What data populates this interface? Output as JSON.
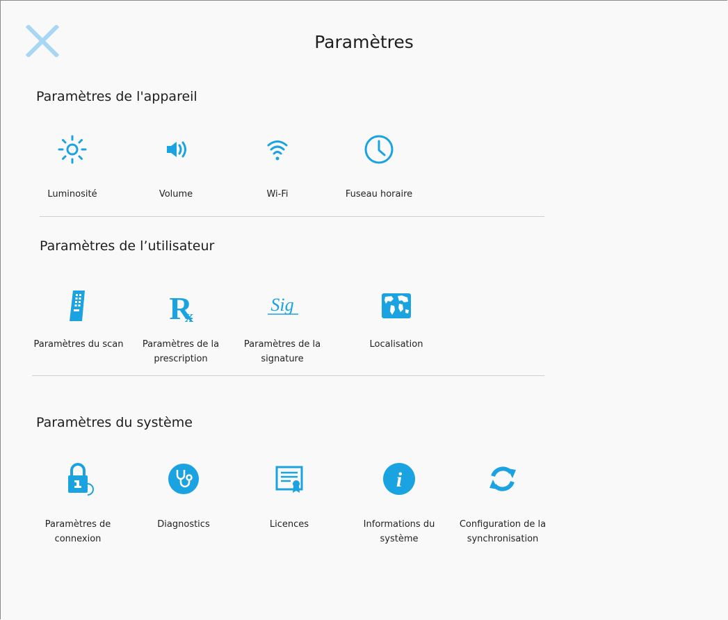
{
  "header": {
    "title": "Paramètres",
    "close_icon": "close-icon"
  },
  "colors": {
    "accent": "#1aa3e0",
    "close": "#a7d7f3",
    "divider": "#cfcfcf"
  },
  "sections": {
    "device": {
      "title": "Paramètres de l'appareil",
      "items": [
        {
          "label": "Luminosité",
          "icon": "brightness-icon"
        },
        {
          "label": "Volume",
          "icon": "volume-icon"
        },
        {
          "label": "Wi-Fi",
          "icon": "wifi-icon"
        },
        {
          "label": "Fuseau horaire",
          "icon": "clock-icon"
        }
      ]
    },
    "user": {
      "title": "Paramètres de l’utilisateur",
      "items": [
        {
          "label": "Paramètres du scan",
          "icon": "scanner-icon"
        },
        {
          "label": "Paramètres de la\nprescription",
          "icon": "rx-icon"
        },
        {
          "label": "Paramètres de la\nsignature",
          "icon": "signature-icon"
        },
        {
          "label": "Localisation",
          "icon": "world-map-icon"
        }
      ]
    },
    "system": {
      "title": "Paramètres du système",
      "items": [
        {
          "label": "Paramètres de\nconnexion",
          "icon": "lock-icon"
        },
        {
          "label": "Diagnostics",
          "icon": "stethoscope-icon"
        },
        {
          "label": "Licences",
          "icon": "certificate-icon"
        },
        {
          "label": "Informations du\nsystème",
          "icon": "info-icon"
        },
        {
          "label": "Configuration de la\nsynchronisation",
          "icon": "sync-icon"
        }
      ]
    }
  }
}
